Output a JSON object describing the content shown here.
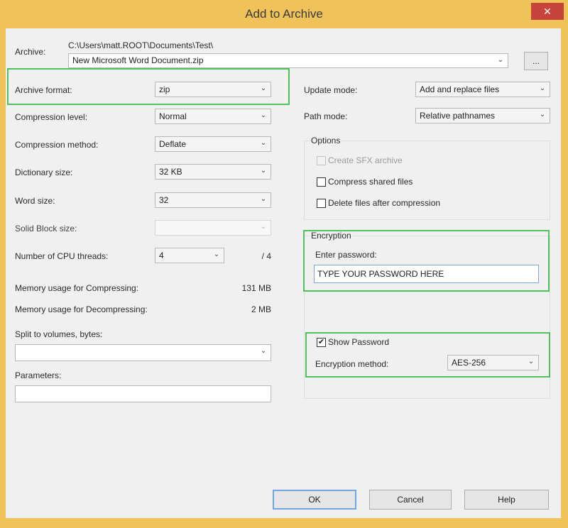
{
  "window": {
    "title": "Add to Archive",
    "close_glyph": "✕",
    "accent_color": "#efc35a",
    "close_color": "#c7443a",
    "highlight_color": "#4fc25f"
  },
  "archive": {
    "label": "Archive:",
    "folder": "C:\\Users\\matt.ROOT\\Documents\\Test\\",
    "filename": "New Microsoft Word Document.zip",
    "browse_label": "..."
  },
  "left": {
    "archive_format": {
      "label": "Archive format:",
      "value": "zip"
    },
    "compression_level": {
      "label": "Compression level:",
      "value": "Normal"
    },
    "compression_method": {
      "label": "Compression method:",
      "value": "Deflate"
    },
    "dictionary_size": {
      "label": "Dictionary size:",
      "value": "32 KB"
    },
    "word_size": {
      "label": "Word size:",
      "value": "32"
    },
    "solid_block_size": {
      "label": "Solid Block size:",
      "value": ""
    },
    "cpu_threads": {
      "label": "Number of CPU threads:",
      "value": "4",
      "total": "/ 4"
    },
    "memory_compress": {
      "label": "Memory usage for Compressing:",
      "value": "131 MB"
    },
    "memory_decompress": {
      "label": "Memory usage for Decompressing:",
      "value": "2 MB"
    },
    "split_volumes": {
      "label": "Split to volumes, bytes:",
      "value": ""
    },
    "parameters": {
      "label": "Parameters:",
      "value": ""
    }
  },
  "right": {
    "update_mode": {
      "label": "Update mode:",
      "value": "Add and replace files"
    },
    "path_mode": {
      "label": "Path mode:",
      "value": "Relative pathnames"
    },
    "options": {
      "title": "Options",
      "create_sfx": {
        "label": "Create SFX archive",
        "checked": false,
        "disabled": true
      },
      "compress_shared": {
        "label": "Compress shared files",
        "checked": false
      },
      "delete_after": {
        "label": "Delete files after compression",
        "checked": false
      }
    },
    "encryption": {
      "title": "Encryption",
      "password_label": "Enter password:",
      "password_value": "TYPE YOUR PASSWORD HERE",
      "show_password": {
        "label": "Show Password",
        "checked": true,
        "glyph": "✔"
      },
      "method_label": "Encryption method:",
      "method_value": "AES-256"
    }
  },
  "buttons": {
    "ok": "OK",
    "cancel": "Cancel",
    "help": "Help"
  },
  "icons": {
    "dropdown": "chevron-down-icon",
    "close": "close-icon",
    "checkbox": "checkmark-icon"
  },
  "chevron_glyph": "⌄"
}
